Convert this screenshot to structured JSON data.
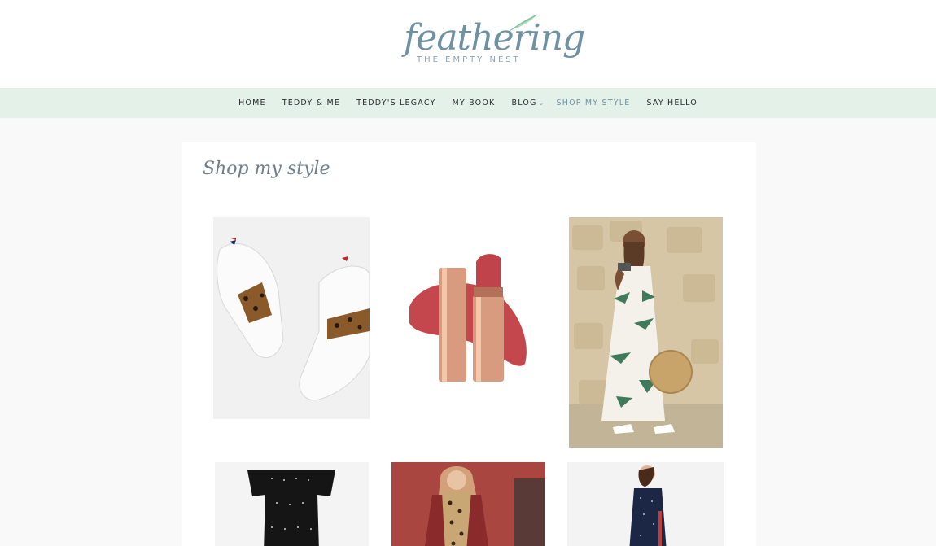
{
  "header": {
    "logo_word": "feathering",
    "logo_tagline": "THE EMPTY NEST"
  },
  "nav": {
    "items": [
      {
        "label": "HOME"
      },
      {
        "label": "TEDDY & ME"
      },
      {
        "label": "TEDDY'S LEGACY"
      },
      {
        "label": "MY BOOK"
      },
      {
        "label": "BLOG"
      },
      {
        "label": "SHOP MY STYLE"
      },
      {
        "label": "SAY HELLO"
      }
    ],
    "blog_dropdown_icon": "chevron-down-icon",
    "active_index": 5
  },
  "main": {
    "title": "Shop my style"
  },
  "colors": {
    "brand": "#6f92a3",
    "nav_bg": "#e3f1e9",
    "page_bg": "#f9f9f9"
  }
}
